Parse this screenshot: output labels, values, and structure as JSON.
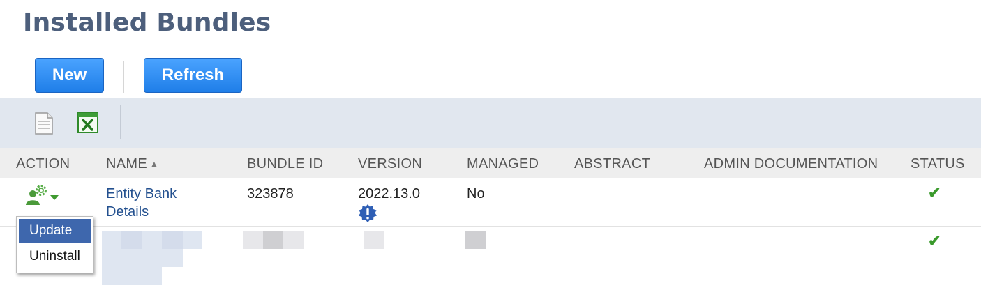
{
  "page": {
    "title": "Installed Bundles"
  },
  "buttons": {
    "new_label": "New",
    "refresh_label": "Refresh"
  },
  "toolbar": {
    "icons": [
      "document-icon",
      "excel-export-icon"
    ]
  },
  "table": {
    "columns": {
      "action": "ACTION",
      "name": "NAME",
      "bundle_id": "BUNDLE ID",
      "version": "VERSION",
      "managed": "MANAGED",
      "abstract": "ABSTRACT",
      "admin_documentation": "ADMIN DOCUMENTATION",
      "status": "STATUS"
    },
    "sort": {
      "column": "name",
      "direction": "ascending"
    },
    "rows": [
      {
        "name": "Entity Bank Details",
        "bundle_id": "323878",
        "version": "2022.13.0",
        "version_alert": true,
        "managed": "No",
        "abstract": "",
        "admin_documentation": "",
        "status_ok": true
      },
      {
        "name": "",
        "bundle_id": "",
        "version": "",
        "managed": "",
        "abstract": "",
        "admin_documentation": "",
        "status_ok": true,
        "redacted": true
      }
    ]
  },
  "action_menu": {
    "items": [
      "Update",
      "Uninstall"
    ],
    "highlighted": "Update"
  },
  "colors": {
    "title": "#4d5f7c",
    "button": "#1f7ee8",
    "link": "#23508f",
    "status_ok": "#3a9a2c",
    "menu_highlight": "#3e67ad",
    "toolbar_bg": "#e1e7ef"
  }
}
